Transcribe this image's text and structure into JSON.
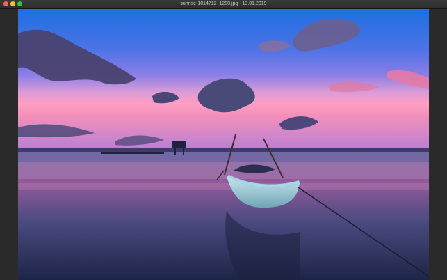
{
  "window": {
    "title": "sunrise-1014712_1280.jpg - 13.01.2019"
  },
  "controls": {
    "close": "close-button",
    "minimize": "minimize-button",
    "zoom": "zoom-button"
  },
  "photo": {
    "alt": "Boat at sunrise on calm water"
  },
  "colors": {
    "titlebar": "#2c2c2c",
    "close": "#fe5f57",
    "minimize": "#febc2e",
    "zoom": "#28c840"
  }
}
